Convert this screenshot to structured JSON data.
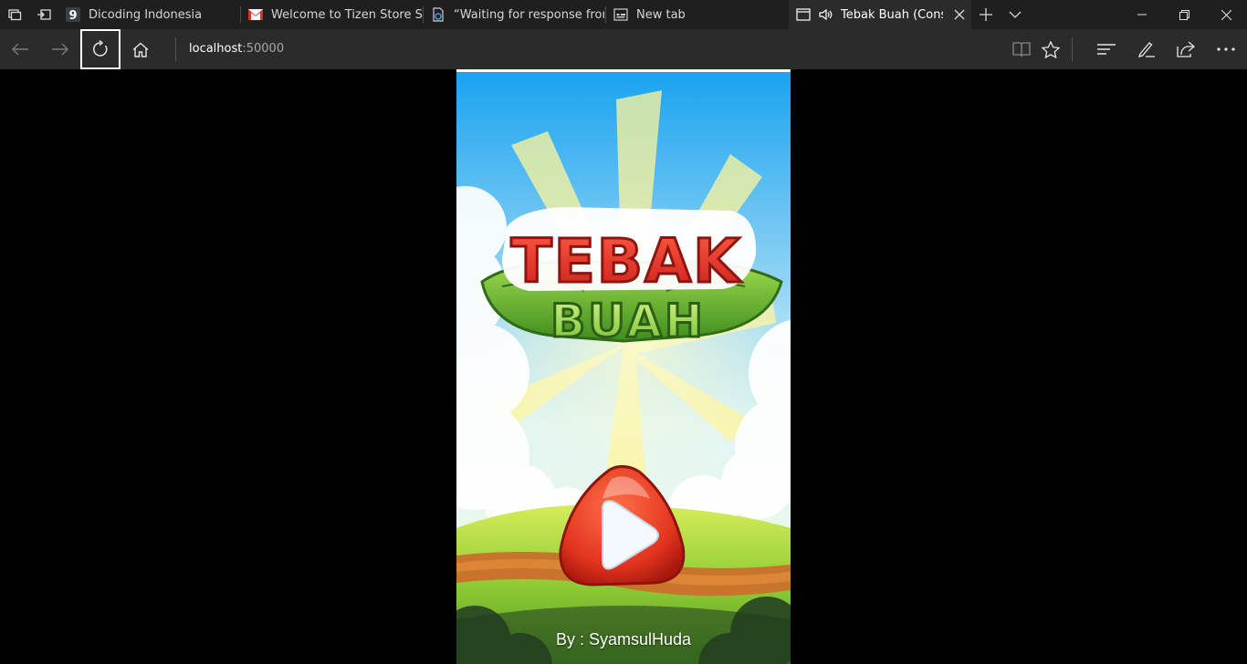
{
  "tabs": [
    {
      "title": "Dicoding Indonesia",
      "favicon": "dicoding-icon"
    },
    {
      "title": "Welcome to Tizen Store Sell",
      "favicon": "gmail-icon"
    },
    {
      "title": "“Waiting for response from",
      "favicon": "loading-page-icon"
    },
    {
      "title": "New tab",
      "favicon": "new-tab-icon"
    },
    {
      "title": "Tebak Buah (Constr",
      "favicon": "page-icon",
      "active": true,
      "audio": true
    }
  ],
  "address": {
    "host": "localhost",
    "port": ":50000"
  },
  "game": {
    "logo_line1": "TEBAK",
    "logo_line2": "BUAH",
    "credit": "By : SyamsulHuda"
  },
  "colors": {
    "chrome_dark": "#1f1f1f",
    "toolbar": "#2b2b2b",
    "sky_top": "#1aa3f0",
    "logo_red": "#e8342c",
    "logo_green": "#7cc63c",
    "play_red": "#e53a22"
  }
}
